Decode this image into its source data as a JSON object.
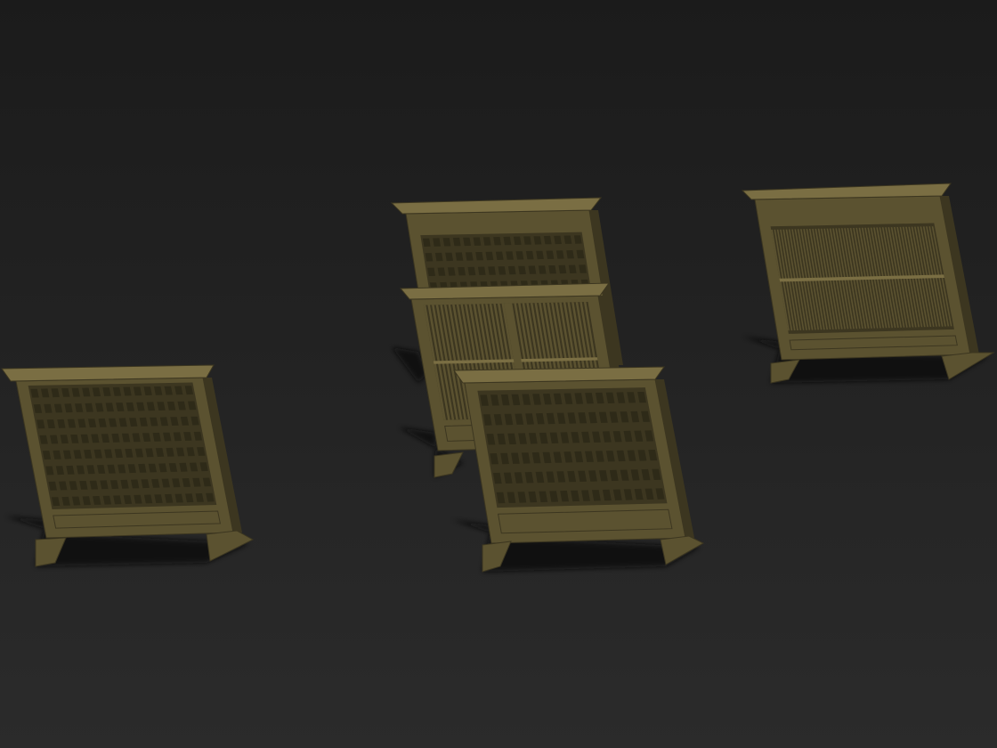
{
  "scene": {
    "background_top": "#1b1b1b",
    "background_bottom": "#2b2b2b",
    "wood_color": "#5b5230",
    "wood_dark": "#3c3620",
    "wood_light": "#7a6e43",
    "shadow_color": "#0b0b0b"
  },
  "objects": [
    {
      "name": "screen-lattice-left",
      "pattern": "lattice"
    },
    {
      "name": "screen-lattice-back",
      "pattern": "lattice"
    },
    {
      "name": "screen-slatted-middle",
      "pattern": "slats"
    },
    {
      "name": "screen-lattice-front",
      "pattern": "lattice"
    },
    {
      "name": "screen-fine-slatted-right",
      "pattern": "fine-slats"
    }
  ]
}
